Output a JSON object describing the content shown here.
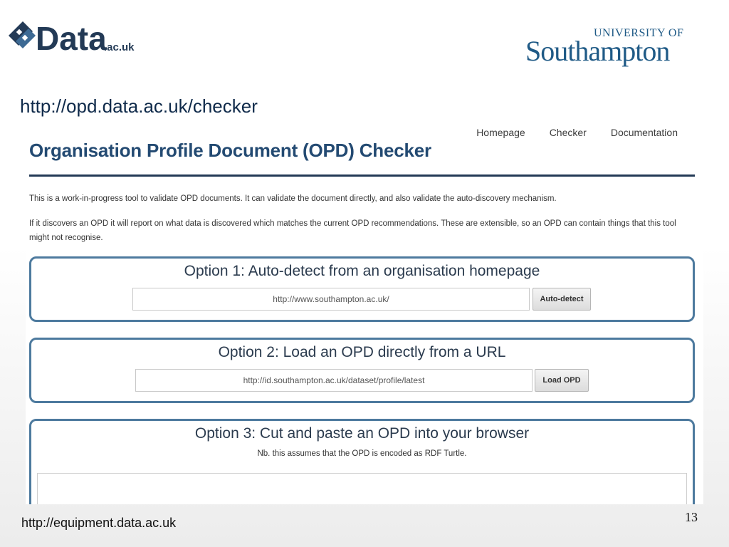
{
  "slide": {
    "url_heading": "http://opd.data.ac.uk/checker",
    "footer_url": "http://equipment.data.ac.uk",
    "page_number": "13"
  },
  "logos": {
    "data_logo": {
      "wordmark": "Data",
      "suffix": ".ac.uk",
      "color": "#233a56"
    },
    "southampton_logo": {
      "line1": "UNIVERSITY OF",
      "line2": "Southampton",
      "color": "#1f5a86"
    }
  },
  "nav": {
    "items": [
      "Homepage",
      "Checker",
      "Documentation"
    ]
  },
  "page": {
    "title": "Organisation Profile Document (OPD) Checker",
    "intro1": "This is a work-in-progress tool to validate OPD documents. It can validate the document directly, and also validate the auto-discovery mechanism.",
    "intro2": "If it discovers an OPD it will report on what data is discovered which matches the current OPD recommendations. These are extensible, so an OPD can contain things that this tool might not recognise."
  },
  "options": [
    {
      "heading": "Option 1: Auto-detect from an organisation homepage",
      "input_value": "http://www.southampton.ac.uk/",
      "button": "Auto-detect"
    },
    {
      "heading": "Option 2: Load an OPD directly from a URL",
      "input_value": "http://id.southampton.ac.uk/dataset/profile/latest",
      "button": "Load OPD"
    },
    {
      "heading": "Option 3: Cut and paste an OPD into your browser",
      "note": "Nb. this assumes that the OPD is encoded as RDF Turtle."
    }
  ],
  "colors": {
    "title": "#234a72",
    "border": "#4d7a9e",
    "rule": "#233a56"
  }
}
